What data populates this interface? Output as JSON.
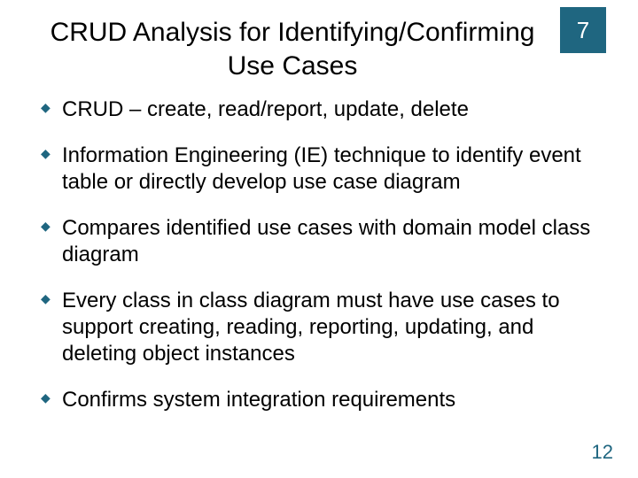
{
  "badge": "7",
  "title": "CRUD Analysis for Identifying/Confirming Use Cases",
  "bullets": [
    "CRUD – create, read/report, update, delete",
    "Information Engineering (IE) technique to identify event table or directly develop use case diagram",
    "Compares identified use cases with domain model class diagram",
    "Every class in class diagram must have use cases to support creating, reading, reporting, updating, and deleting object instances",
    "Confirms system integration requirements"
  ],
  "page_number": "12"
}
